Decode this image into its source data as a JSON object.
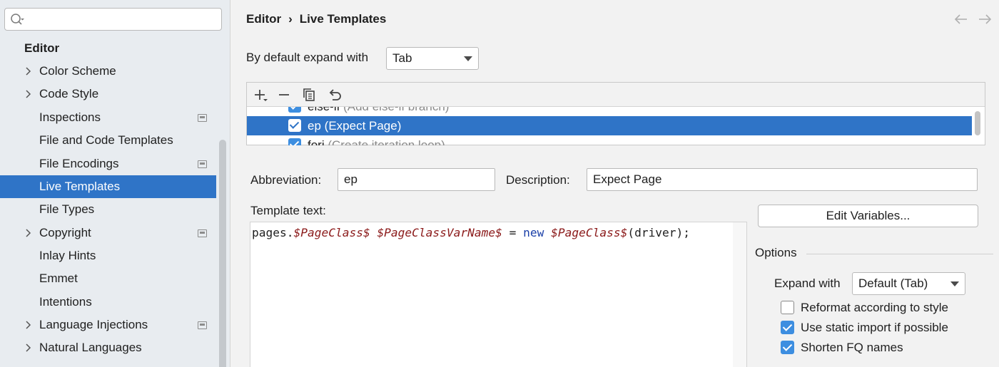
{
  "search": {
    "placeholder": "",
    "value": ""
  },
  "sidebar": {
    "heading": "Editor",
    "items": [
      {
        "label": "Color Scheme",
        "expandable": true,
        "project": false
      },
      {
        "label": "Code Style",
        "expandable": true,
        "project": false
      },
      {
        "label": "Inspections",
        "expandable": false,
        "project": true
      },
      {
        "label": "File and Code Templates",
        "expandable": false,
        "project": false
      },
      {
        "label": "File Encodings",
        "expandable": false,
        "project": true
      },
      {
        "label": "Live Templates",
        "expandable": false,
        "project": false,
        "selected": true
      },
      {
        "label": "File Types",
        "expandable": false,
        "project": false
      },
      {
        "label": "Copyright",
        "expandable": true,
        "project": true
      },
      {
        "label": "Inlay Hints",
        "expandable": false,
        "project": false
      },
      {
        "label": "Emmet",
        "expandable": false,
        "project": false
      },
      {
        "label": "Intentions",
        "expandable": false,
        "project": false
      },
      {
        "label": "Language Injections",
        "expandable": true,
        "project": true
      },
      {
        "label": "Natural Languages",
        "expandable": true,
        "project": false
      }
    ]
  },
  "breadcrumb": {
    "parent": "Editor",
    "separator": "›",
    "current": "Live Templates"
  },
  "expand": {
    "label": "By default expand with",
    "value": "Tab"
  },
  "template_list": {
    "rows": [
      {
        "name": "else-if",
        "description": "(Add else-if branch)"
      },
      {
        "name": "ep",
        "description": "(Expect Page)",
        "selected": true
      },
      {
        "name": "fori",
        "description": "(Create iteration loop)"
      }
    ]
  },
  "abbreviation": {
    "label": "Abbreviation:",
    "value": "ep"
  },
  "description": {
    "label": "Description:",
    "value": "Expect Page"
  },
  "template_text": {
    "label": "Template text:",
    "code": {
      "p1": "pages.",
      "v1": "$PageClass$",
      "p2": " ",
      "v2": "$PageClassVarName$",
      "p3": " = ",
      "kw": "new",
      "p4": " ",
      "v3": "$PageClass$",
      "p5": "(driver);"
    }
  },
  "edit_variables_label": "Edit Variables...",
  "options": {
    "title": "Options",
    "expand_with_label": "Expand with",
    "expand_with_value": "Default (Tab)",
    "checks": [
      {
        "label": "Reformat according to style",
        "checked": false
      },
      {
        "label": "Use static import if possible",
        "checked": true
      },
      {
        "label": "Shorten FQ names",
        "checked": true
      }
    ]
  },
  "colors": {
    "selection": "#2f74c7",
    "checkbox": "#3d8ee0",
    "template_var": "#8b1a1a",
    "keyword": "#1a3fa8"
  }
}
